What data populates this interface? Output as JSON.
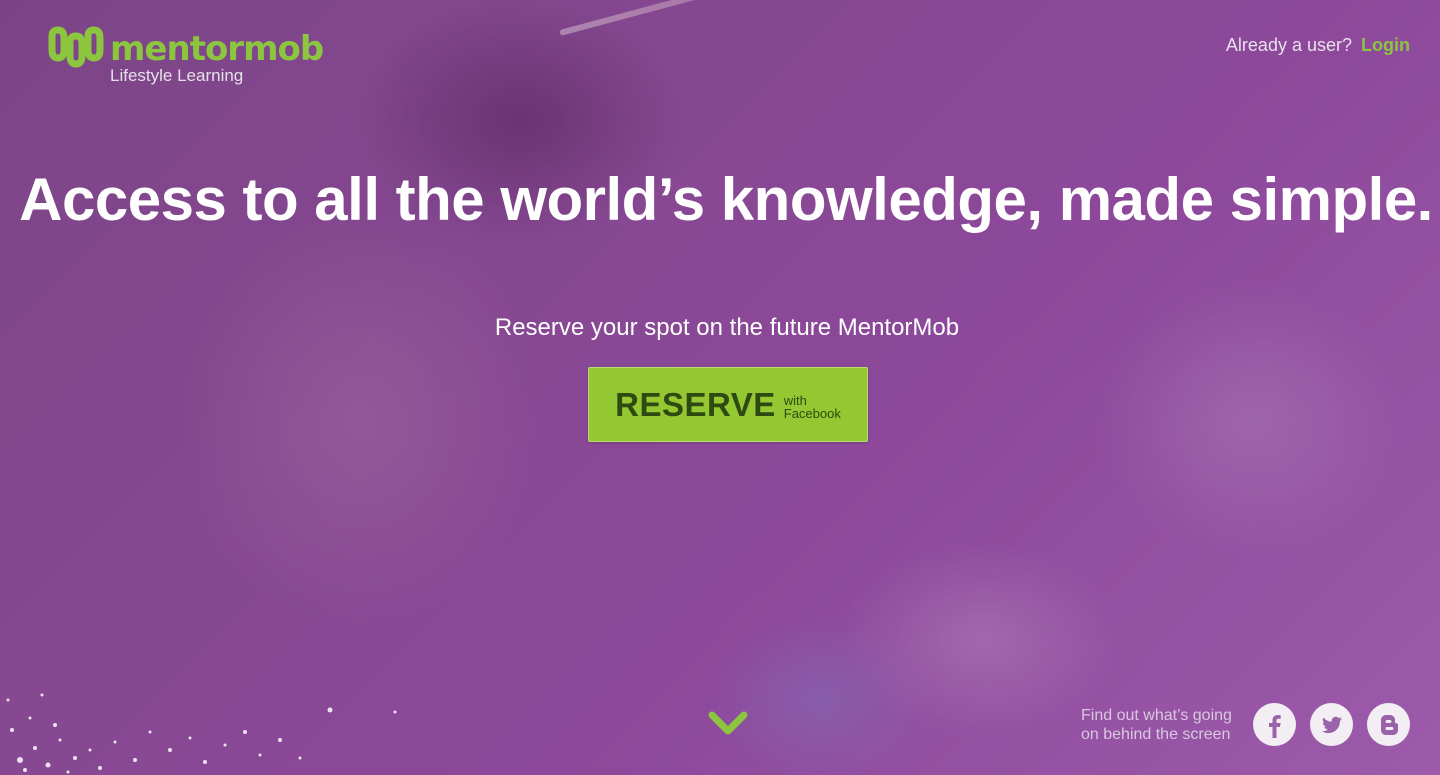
{
  "brand": {
    "name_part1": "mentor",
    "name_part2": "mob",
    "tagline": "Lifestyle Learning",
    "accent_color": "#8cc63f"
  },
  "header": {
    "login_prompt": "Already a user?",
    "login_label": "Login"
  },
  "hero": {
    "headline": "Access to all the world’s knowledge, made simple.",
    "subline": "Reserve your spot on the future MentorMob",
    "reserve_label": "RESERVE",
    "reserve_with": "with",
    "reserve_provider": "Facebook",
    "button_color": "#94c832",
    "overlay_color": "#8a4f94"
  },
  "footer": {
    "text_line1": "Find out what’s going",
    "text_line2": "on behind the screen",
    "social_icons": [
      "facebook-icon",
      "twitter-icon",
      "blogger-icon"
    ]
  }
}
